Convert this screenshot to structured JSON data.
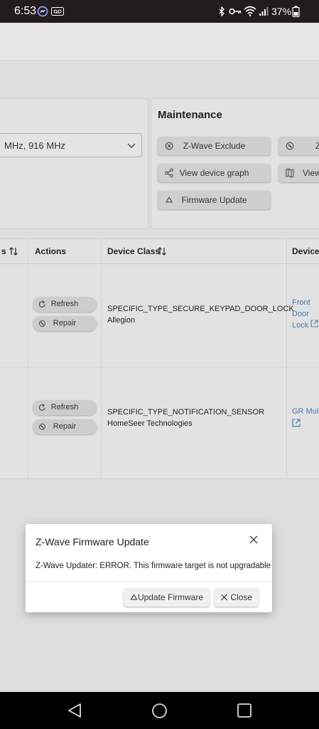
{
  "status_bar": {
    "time": "6:53",
    "battery": "37%",
    "icons": [
      "messenger-icon",
      "voicemail-icon",
      "bluetooth-icon",
      "key-icon",
      "wifi-icon",
      "signal-icon",
      "battery-icon"
    ]
  },
  "frequency_select": {
    "value": "MHz, 916 MHz"
  },
  "maintenance": {
    "title": "Maintenance",
    "buttons": {
      "exclude": "Z-Wave Exclude",
      "exclude_partial": "Z",
      "view_graph": "View device graph",
      "view_partial": "View",
      "firmware_update": "Firmware Update"
    }
  },
  "table": {
    "headers": {
      "partial": "s",
      "actions": "Actions",
      "device_class": "Device Class",
      "device": "Device"
    },
    "refresh_label": "Refresh",
    "repair_label": "Repair",
    "rows": [
      {
        "class_type": "SPECIFIC_TYPE_SECURE_KEYPAD_DOOR_LOCK",
        "manufacturer": "Allegion",
        "device_lines": [
          "Front",
          "Door",
          "Lock"
        ]
      },
      {
        "class_type": "SPECIFIC_TYPE_NOTIFICATION_SENSOR",
        "manufacturer": "HomeSeer Technologies",
        "device_lines": [
          "GR Mul"
        ]
      }
    ]
  },
  "dialog": {
    "title": "Z-Wave Firmware Update",
    "message": "Z-Wave Updater: ERROR. This firmware target is not upgradable",
    "update_button": "Update Firmware",
    "close_button": "Close"
  },
  "colors": {
    "link": "#4b78a6",
    "overlay": "#dedede",
    "status_bar": "#211d1c"
  }
}
